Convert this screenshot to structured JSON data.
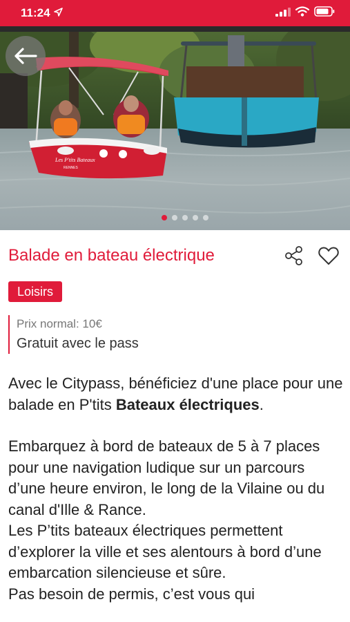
{
  "status_bar": {
    "time": "11:24",
    "icons": [
      "location-arrow-icon",
      "signal-icon",
      "wifi-icon",
      "battery-icon"
    ]
  },
  "hero": {
    "boat_sign_1": "Les P'tits Bateaux",
    "boat_sign_2": "RENNES",
    "carousel": {
      "count": 5,
      "active": 0
    }
  },
  "activity": {
    "title": "Balade en bateau électrique",
    "category": "Loisirs",
    "price_normal": "Prix normal: 10€",
    "price_pass": "Gratuit avec le pass"
  },
  "description": {
    "p1_text": "Avec le Citypass, bénéficiez d'une place pour une balade en P'tits ",
    "p1_bold": "Bateaux électriques",
    "p1_end": ".",
    "p2": "Embarquez à bord de bateaux de 5 à 7 places pour une navigation ludique sur un parcours d’une heure environ, le long de la Vilaine ou du canal d'Ille & Rance.",
    "p3": "Les P’tits bateaux électriques permettent d’explorer la ville et ses alentours à bord d’une embarcation silencieuse et sûre.",
    "p4": "Pas besoin de permis, c’est vous qui"
  },
  "colors": {
    "accent": "#e01b3a",
    "text": "#1a1a1a",
    "muted": "#777777"
  }
}
